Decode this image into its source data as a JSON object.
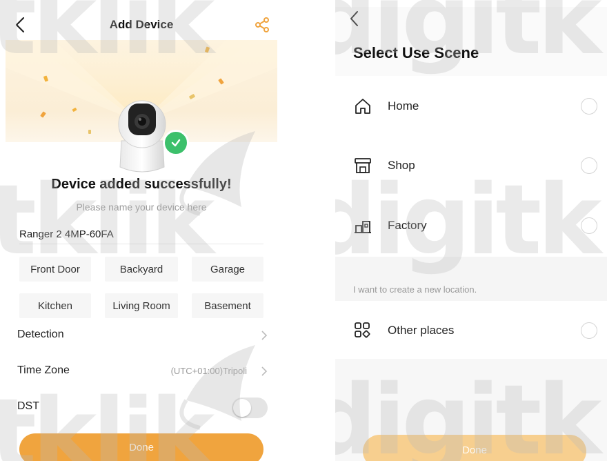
{
  "add_device": {
    "title": "Add Device",
    "success_message": "Device added successfully!",
    "name_placeholder": "Please name your device here",
    "device_name": "Ranger 2 4MP-60FA",
    "name_chips": [
      "Front Door",
      "Backyard",
      "Garage",
      "Kitchen",
      "Living Room",
      "Basement"
    ],
    "settings": {
      "detection_label": "Detection",
      "time_zone_label": "Time Zone",
      "time_zone_value": "(UTC+01:00)Tripoli",
      "dst_label": "DST",
      "dst_enabled": false
    },
    "done_label": "Done",
    "accent_color": "#f0a43e",
    "success_color": "#3cc06b"
  },
  "select_scene": {
    "title": "Select Use Scene",
    "options": [
      {
        "label": "Home",
        "icon": "home-icon",
        "selected": false
      },
      {
        "label": "Shop",
        "icon": "shop-icon",
        "selected": false
      },
      {
        "label": "Factory",
        "icon": "factory-icon",
        "selected": false
      }
    ],
    "new_location_hint": "I want to create a new location.",
    "other_option": {
      "label": "Other places",
      "icon": "grid-icon",
      "selected": false
    },
    "done_label": "Done",
    "done_color": "#f7cf8f"
  },
  "watermark": {
    "left_text": "tklik",
    "right_text": "digitk"
  }
}
